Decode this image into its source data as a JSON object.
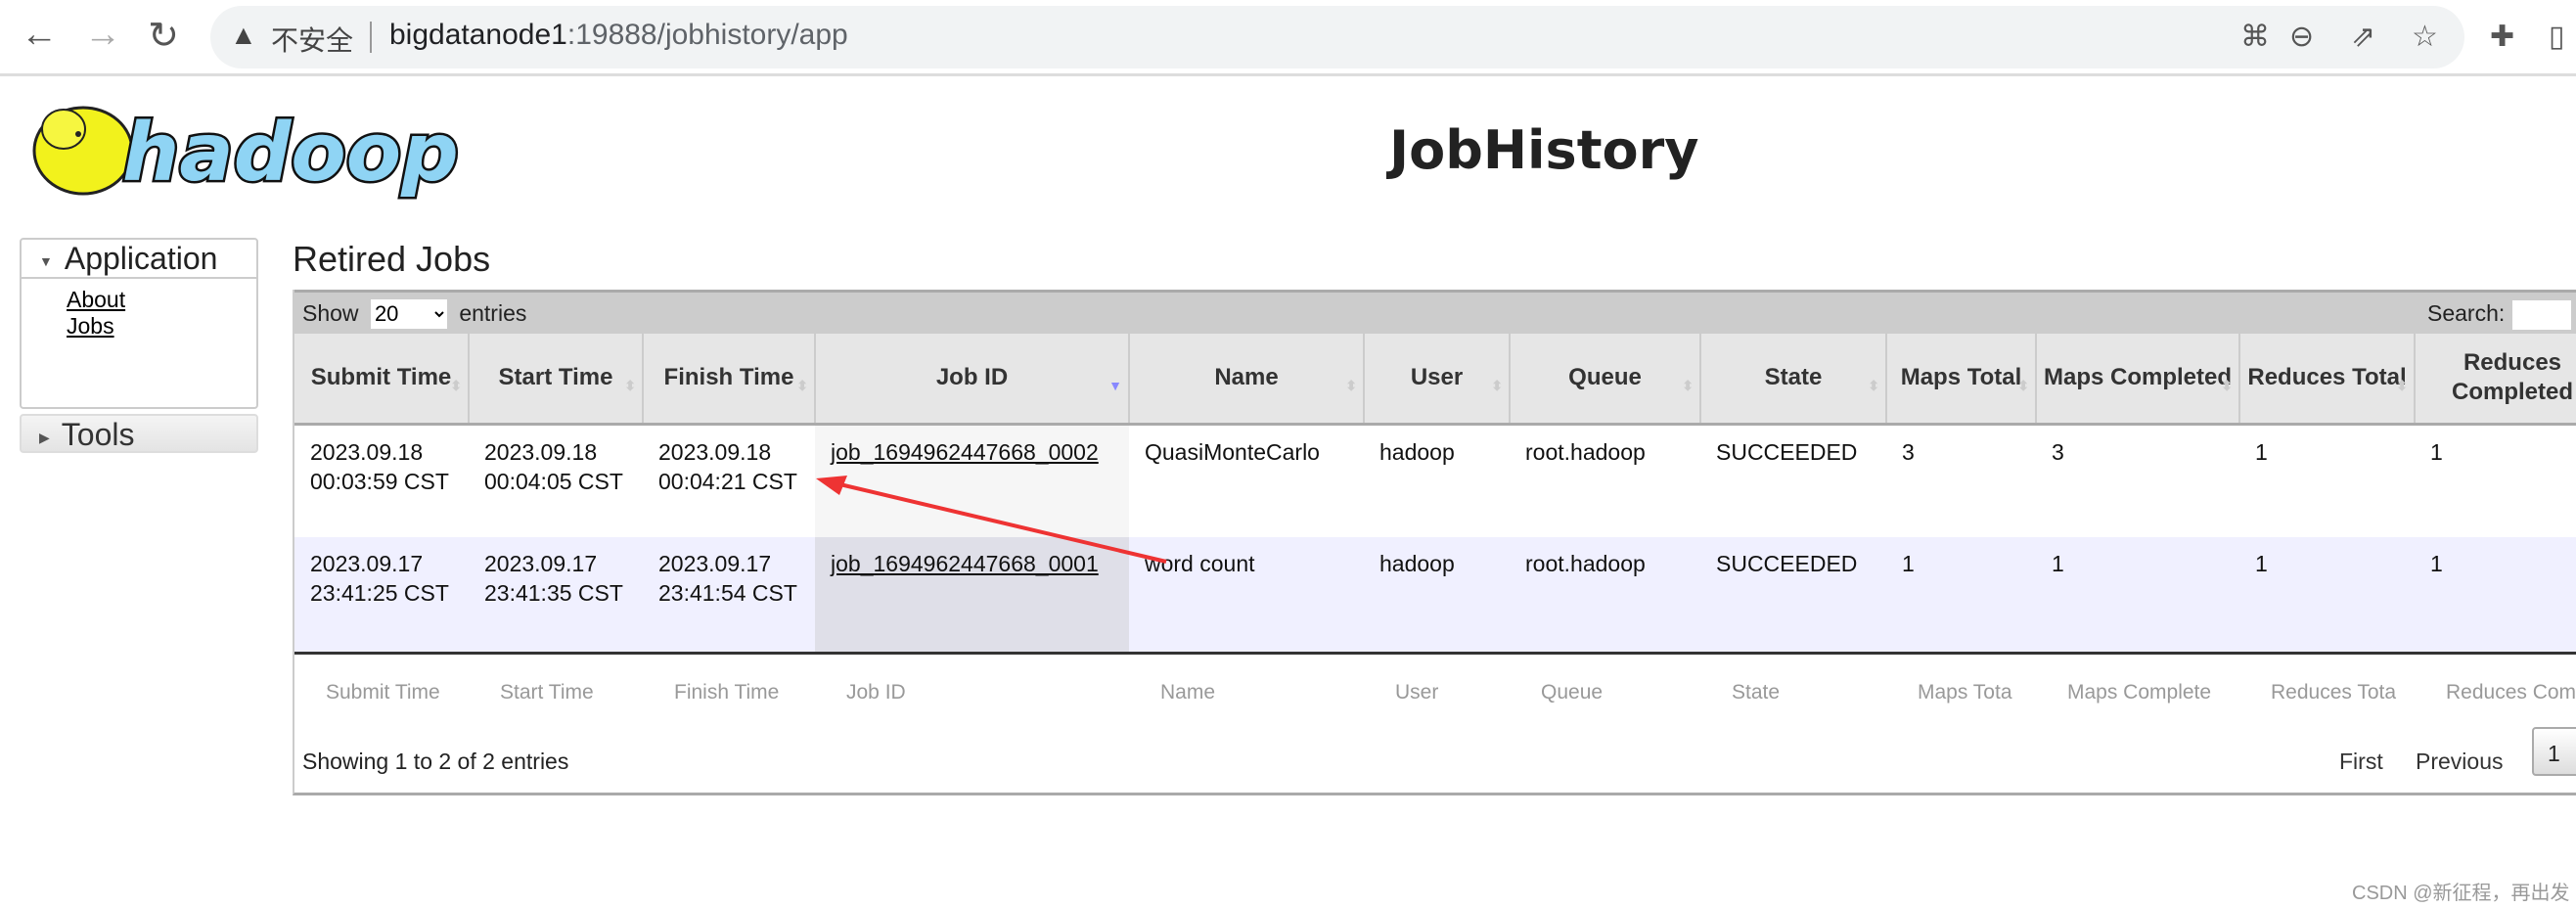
{
  "browser": {
    "insecure_label": "不安全",
    "url_host": "bigdatanode1",
    "url_rest": ":19888/jobhistory/app",
    "icons": [
      "back-icon",
      "forward-icon",
      "reload-icon",
      "warning-icon",
      "translate-icon",
      "zoom-out-icon",
      "share-icon",
      "bookmark-star-icon",
      "extensions-icon",
      "side-panel-icon"
    ]
  },
  "header": {
    "logo_text": "hadoop",
    "title": "JobHistory"
  },
  "sidebar": {
    "application": "Application",
    "items": [
      {
        "label": "About"
      },
      {
        "label": "Jobs"
      }
    ],
    "tools": "Tools"
  },
  "main": {
    "heading": "Retired Jobs",
    "show_label": "Show",
    "entries_label": "entries",
    "page_size": "20",
    "search_label": "Search:",
    "search_value": ""
  },
  "table": {
    "columns": [
      "Submit Time",
      "Start Time",
      "Finish Time",
      "Job ID",
      "Name",
      "User",
      "Queue",
      "State",
      "Maps Total",
      "Maps Completed",
      "Reduces Total",
      "Reduces Completed"
    ],
    "footer_columns": [
      "Submit Time",
      "Start Time",
      "Finish Time",
      "Job ID",
      "Name",
      "User",
      "Queue",
      "State",
      "Maps Tota",
      "Maps Complete",
      "Reduces Tota",
      "Reduces Com"
    ],
    "rows": [
      [
        "2023.09.18 00:03:59 CST",
        "2023.09.18 00:04:05 CST",
        "2023.09.18 00:04:21 CST",
        "job_1694962447668_0002",
        "QuasiMonteCarlo",
        "hadoop",
        "root.hadoop",
        "SUCCEEDED",
        "3",
        "3",
        "1",
        "1"
      ],
      [
        "2023.09.17 23:41:25 CST",
        "2023.09.17 23:41:35 CST",
        "2023.09.17 23:41:54 CST",
        "job_1694962447668_0001",
        "word count",
        "hadoop",
        "root.hadoop",
        "SUCCEEDED",
        "1",
        "1",
        "1",
        "1"
      ]
    ],
    "sorted_column": "Job ID"
  },
  "footer": {
    "info": "Showing 1 to 2 of 2 entries",
    "first": "First",
    "previous": "Previous",
    "page": "1"
  },
  "annotation_color": "#ee3333",
  "watermark": "CSDN @新征程，再出发"
}
